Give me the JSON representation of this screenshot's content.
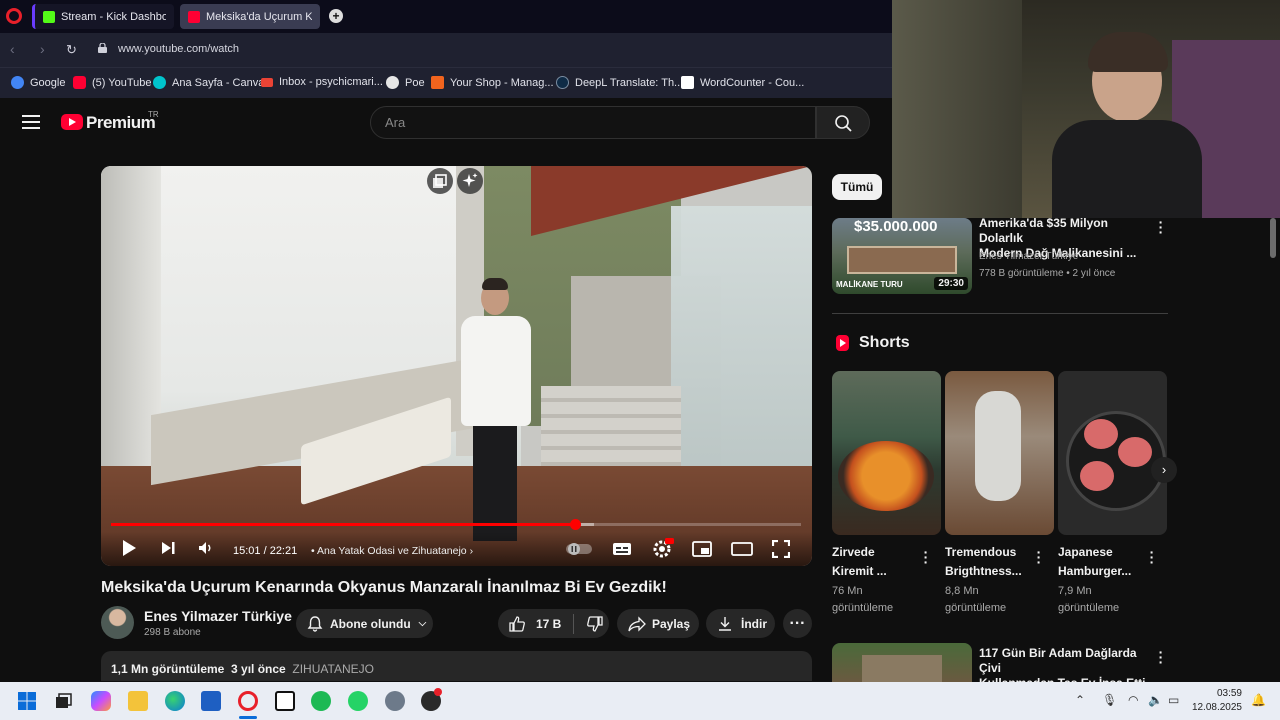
{
  "browser": {
    "tabs": [
      {
        "title": "Stream - Kick Dashboard",
        "fav_color": "#53fc18"
      },
      {
        "title": "Meksika'da Uçurum Kenar",
        "fav_color": "#ff0033"
      }
    ],
    "url": "www.youtube.com/watch",
    "bookmarks": [
      {
        "label": "Google",
        "icon": "google-icon",
        "color": "#4285f4"
      },
      {
        "label": "(5) YouTube",
        "icon": "youtube-icon",
        "color": "#ff0033"
      },
      {
        "label": "Ana Sayfa - Canva",
        "icon": "canva-icon",
        "color": "#00c4cc"
      },
      {
        "label": "Inbox - psychicmari...",
        "icon": "gmail-icon",
        "color": "#ea4335"
      },
      {
        "label": "Poe",
        "icon": "poe-icon",
        "color": "#e6e6e6"
      },
      {
        "label": "Your Shop - Manag...",
        "icon": "etsy-icon",
        "color": "#f1641e"
      },
      {
        "label": "DeepL Translate: Th...",
        "icon": "deepl-icon",
        "color": "#0f2b46"
      },
      {
        "label": "WordCounter - Cou...",
        "icon": "wordcounter-icon",
        "color": "#ffffff"
      }
    ]
  },
  "youtube": {
    "brand": "Premium",
    "country": "TR",
    "search_placeholder": "Ara",
    "player": {
      "time": "15:01 / 22:21",
      "chapter": "• Ana Yatak Odasi ve Zihuatanejo",
      "progress_played_fraction": 0.672,
      "progress_buffered_fraction": 0.7
    },
    "video": {
      "title": "Meksika'da Uçurum Kenarında Okyanus Manzaralı İnanılmaz Bi Ev Gezdik!",
      "channel": "Enes Yilmazer Türkiye",
      "subscribers": "298 B abone",
      "subscribe_label": "Abone olundu",
      "likes": "17 B",
      "share_label": "Paylaş",
      "download_label": "İndir",
      "views": "1,1 Mn görüntüleme",
      "age": "3 yıl önce",
      "tag": "ZIHUATANEJO"
    },
    "filter_chip": "Tümü",
    "recommended": [
      {
        "title_line1": "Amerika'da $35 Milyon Dolarlık",
        "title_line2": "Modern Dağ Malikanesini ...",
        "channel": "Enes Yilmazer Türkiye",
        "meta": "778 B görüntüleme • 2 yıl önce",
        "duration": "29:30",
        "thumb_price": "$35.000.000",
        "thumb_caption": "MALİKANE TURU"
      },
      {
        "title_line1": "117 Gün Bir Adam Dağlarda Çivi",
        "title_line2": "Kullanmadan Taş Ev İnşa Etti"
      }
    ],
    "shorts_heading": "Shorts",
    "shorts": [
      {
        "title_line1": "Zirvede",
        "title_line2": "Kiremit ...",
        "views_line1": "76 Mn",
        "views_line2": "görüntüleme"
      },
      {
        "title_line1": "Tremendous",
        "title_line2": "Brigthtness...",
        "views_line1": "8,8 Mn",
        "views_line2": "görüntüleme"
      },
      {
        "title_line1": "Japanese",
        "title_line2": "Hamburger...",
        "views_line1": "7,9 Mn",
        "views_line2": "görüntüleme"
      }
    ]
  },
  "taskbar": {
    "time": "03:59",
    "date": "12.08.2025"
  }
}
